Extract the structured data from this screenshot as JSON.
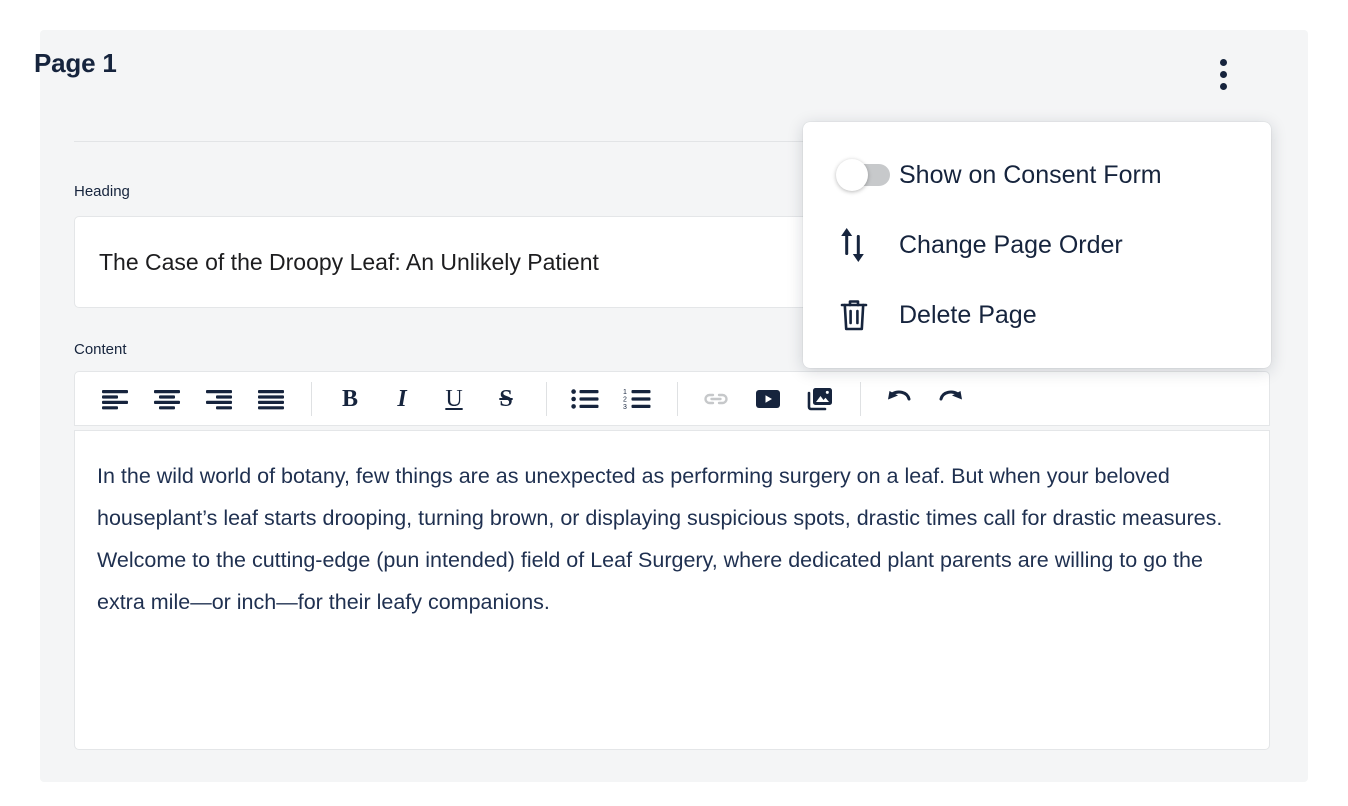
{
  "header": {
    "title": "Page 1",
    "menu_icon": "kebab-menu-icon"
  },
  "fields": {
    "heading_label": "Heading",
    "heading_value": "The Case of the Droopy Leaf: An Unlikely Patient",
    "content_label": "Content",
    "content_value": "In the wild world of botany, few things are as unexpected as performing surgery on a leaf. But when your beloved houseplant’s leaf starts drooping, turning brown, or displaying suspicious spots, drastic times call for drastic measures. Welcome to the cutting-edge (pun intended) field of Leaf Surgery, where dedicated plant parents are willing to go the extra mile—or inch—for their leafy companions."
  },
  "toolbar": {
    "buttons": [
      {
        "name": "align-left-icon",
        "label": "Align left",
        "disabled": false
      },
      {
        "name": "align-center-icon",
        "label": "Align center",
        "disabled": false
      },
      {
        "name": "align-right-icon",
        "label": "Align right",
        "disabled": false
      },
      {
        "name": "align-justify-icon",
        "label": "Justify",
        "disabled": false
      },
      {
        "name": "bold-icon",
        "label": "B",
        "disabled": false
      },
      {
        "name": "italic-icon",
        "label": "I",
        "disabled": false
      },
      {
        "name": "underline-icon",
        "label": "U",
        "disabled": false
      },
      {
        "name": "strikethrough-icon",
        "label": "S",
        "disabled": false
      },
      {
        "name": "bulleted-list-icon",
        "label": "Bulleted list",
        "disabled": false
      },
      {
        "name": "numbered-list-icon",
        "label": "Numbered list",
        "disabled": false
      },
      {
        "name": "link-icon",
        "label": "Insert link",
        "disabled": true
      },
      {
        "name": "video-icon",
        "label": "Insert video",
        "disabled": false
      },
      {
        "name": "image-icon",
        "label": "Insert image",
        "disabled": false
      },
      {
        "name": "undo-icon",
        "label": "Undo",
        "disabled": false
      },
      {
        "name": "redo-icon",
        "label": "Redo",
        "disabled": false
      }
    ],
    "numbered_list_markers": [
      "1",
      "2",
      "3"
    ]
  },
  "dropdown": {
    "items": [
      {
        "label": "Show on Consent Form",
        "icon": "toggle-switch-icon",
        "toggle_state": "off"
      },
      {
        "label": "Change Page Order",
        "icon": "change-order-icon"
      },
      {
        "label": "Delete Page",
        "icon": "trash-icon"
      }
    ]
  },
  "colors": {
    "navy": "#16243d",
    "panel_bg": "#f4f5f6",
    "card_bg": "#ffffff",
    "border": "#e4e6e8",
    "toggle_off_track": "#c7c9cb",
    "disabled_icon": "#c6c8ca"
  }
}
